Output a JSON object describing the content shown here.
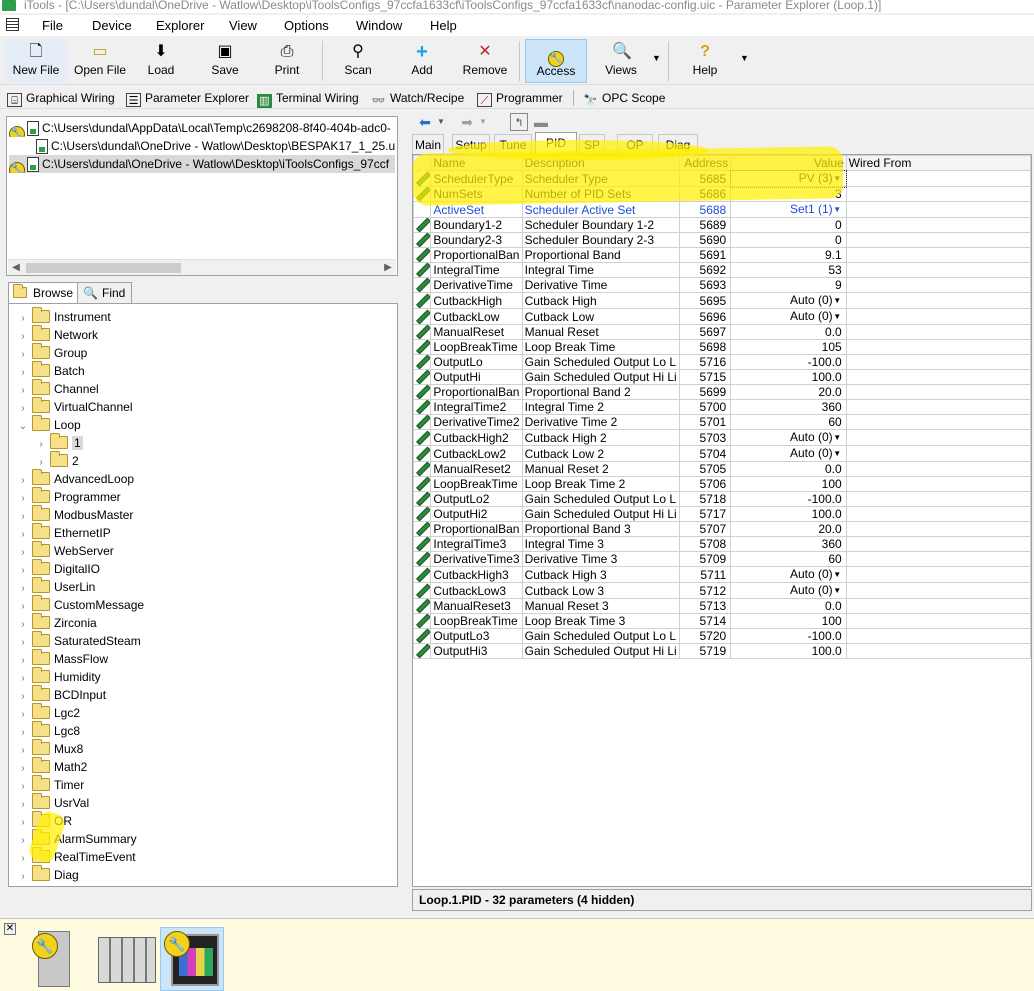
{
  "window": {
    "title": "iTools - [C:\\Users\\dundal\\OneDrive - Watlow\\Desktop\\iToolsConfigs_97ccfa1633cf\\iToolsConfigs_97ccfa1633cf\\nanodac-config.uic - Parameter Explorer (Loop.1)]"
  },
  "menu": [
    "File",
    "Device",
    "Explorer",
    "View",
    "Options",
    "Window",
    "Help"
  ],
  "toolbar": [
    {
      "label": "New File",
      "icon": "new-file-icon"
    },
    {
      "label": "Open File",
      "icon": "open-file-icon"
    },
    {
      "label": "Load",
      "icon": "load-icon"
    },
    {
      "label": "Save",
      "icon": "save-icon"
    },
    {
      "label": "Print",
      "icon": "print-icon"
    },
    {
      "label": "Scan",
      "icon": "scan-icon"
    },
    {
      "label": "Add",
      "icon": "add-icon"
    },
    {
      "label": "Remove",
      "icon": "remove-icon"
    },
    {
      "label": "Access",
      "icon": "access-key-icon"
    },
    {
      "label": "Views",
      "icon": "views-magnifier-icon"
    },
    {
      "label": "Help",
      "icon": "help-icon"
    }
  ],
  "views": [
    "Graphical Wiring",
    "Parameter Explorer",
    "Terminal Wiring",
    "Watch/Recipe",
    "Programmer",
    "OPC Scope"
  ],
  "files": [
    "C:\\Users\\dundal\\AppData\\Local\\Temp\\c2698208-8f40-404b-adc0-",
    "C:\\Users\\dundal\\OneDrive - Watlow\\Desktop\\BESPAK17_1_25.uic",
    "C:\\Users\\dundal\\OneDrive - Watlow\\Desktop\\iToolsConfigs_97ccf"
  ],
  "tree_tabs": [
    "Browse",
    "Find"
  ],
  "tree": [
    "Instrument",
    "Network",
    "Group",
    "Batch",
    "Channel",
    "VirtualChannel",
    "Loop",
    "1",
    "2",
    "AdvancedLoop",
    "Programmer",
    "ModbusMaster",
    "EthernetIP",
    "WebServer",
    "DigitalIO",
    "UserLin",
    "CustomMessage",
    "Zirconia",
    "SaturatedSteam",
    "MassFlow",
    "Humidity",
    "BCDInput",
    "Lgc2",
    "Lgc8",
    "Mux8",
    "Math2",
    "Timer",
    "UsrVal",
    "OR",
    "AlarmSummary",
    "RealTimeEvent",
    "Diag"
  ],
  "param_tabs": [
    "Main",
    "Setup",
    "Tune",
    "PID",
    "SP",
    "OP",
    "Diag"
  ],
  "columns": [
    "Name",
    "Description",
    "Address",
    "Value",
    "Wired From"
  ],
  "rows": [
    [
      "SchedulerType",
      "Scheduler Type",
      "5685",
      "PV (3)"
    ],
    [
      "NumSets",
      "Number of PID Sets",
      "5686",
      "3"
    ],
    [
      "ActiveSet",
      "Scheduler Active Set",
      "5688",
      "Set1 (1)"
    ],
    [
      "Boundary1-2",
      "Scheduler Boundary 1-2",
      "5689",
      "0"
    ],
    [
      "Boundary2-3",
      "Scheduler Boundary 2-3",
      "5690",
      "0"
    ],
    [
      "ProportionalBan",
      "Proportional Band",
      "5691",
      "9.1"
    ],
    [
      "IntegralTime",
      "Integral Time",
      "5692",
      "53"
    ],
    [
      "DerivativeTime",
      "Derivative Time",
      "5693",
      "9"
    ],
    [
      "CutbackHigh",
      "Cutback High",
      "5695",
      "Auto (0)"
    ],
    [
      "CutbackLow",
      "Cutback Low",
      "5696",
      "Auto (0)"
    ],
    [
      "ManualReset",
      "Manual Reset",
      "5697",
      "0.0"
    ],
    [
      "LoopBreakTime",
      "Loop Break Time",
      "5698",
      "105"
    ],
    [
      "OutputLo",
      "Gain Scheduled Output Lo L",
      "5716",
      "-100.0"
    ],
    [
      "OutputHi",
      "Gain Scheduled Output Hi Li",
      "5715",
      "100.0"
    ],
    [
      "ProportionalBan",
      "Proportional Band 2",
      "5699",
      "20.0"
    ],
    [
      "IntegralTime2",
      "Integral Time 2",
      "5700",
      "360"
    ],
    [
      "DerivativeTime2",
      "Derivative Time 2",
      "5701",
      "60"
    ],
    [
      "CutbackHigh2",
      "Cutback High 2",
      "5703",
      "Auto (0)"
    ],
    [
      "CutbackLow2",
      "Cutback Low 2",
      "5704",
      "Auto (0)"
    ],
    [
      "ManualReset2",
      "Manual Reset 2",
      "5705",
      "0.0"
    ],
    [
      "LoopBreakTime",
      "Loop Break Time 2",
      "5706",
      "100"
    ],
    [
      "OutputLo2",
      "Gain Scheduled Output Lo L",
      "5718",
      "-100.0"
    ],
    [
      "OutputHi2",
      "Gain Scheduled Output Hi Li",
      "5717",
      "100.0"
    ],
    [
      "ProportionalBan",
      "Proportional Band 3",
      "5707",
      "20.0"
    ],
    [
      "IntegralTime3",
      "Integral Time 3",
      "5708",
      "360"
    ],
    [
      "DerivativeTime3",
      "Derivative Time 3",
      "5709",
      "60"
    ],
    [
      "CutbackHigh3",
      "Cutback High 3",
      "5711",
      "Auto (0)"
    ],
    [
      "CutbackLow3",
      "Cutback Low 3",
      "5712",
      "Auto (0)"
    ],
    [
      "ManualReset3",
      "Manual Reset 3",
      "5713",
      "0.0"
    ],
    [
      "LoopBreakTime",
      "Loop Break Time 3",
      "5714",
      "100"
    ],
    [
      "OutputLo3",
      "Gain Scheduled Output Lo L",
      "5720",
      "-100.0"
    ],
    [
      "OutputHi3",
      "Gain Scheduled Output Hi Li",
      "5719",
      "100.0"
    ]
  ],
  "status": "Loop.1.PID  -  32 parameters (4 hidden)",
  "colors": {
    "highlight": "#fff000",
    "readonly_text": "#1f4fd8",
    "accent": "#f3d21c"
  }
}
